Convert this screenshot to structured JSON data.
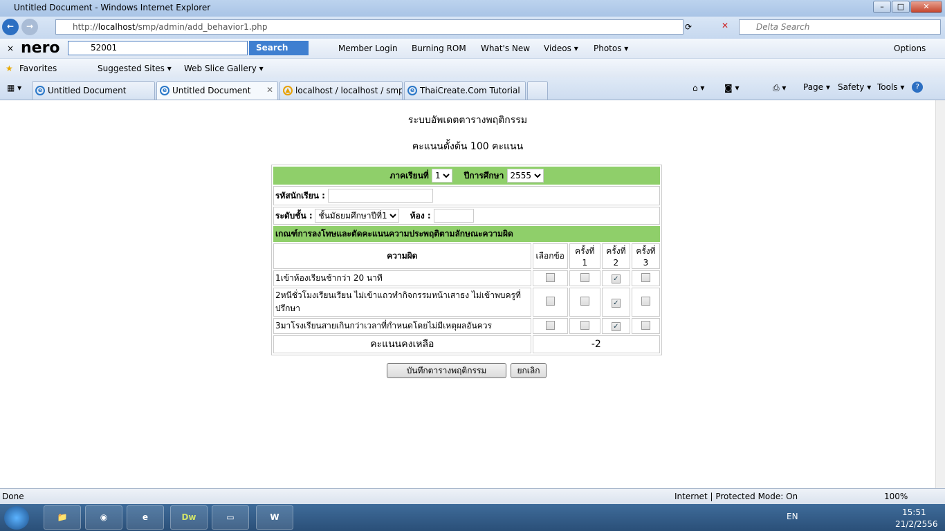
{
  "window": {
    "title": "Untitled Document - Windows Internet Explorer"
  },
  "nav": {
    "url_prefix": "http://",
    "url_host": "localhost",
    "url_path": "/smp/admin/add_behavior1.php",
    "search_placeholder": "Delta Search"
  },
  "nero": {
    "query": "52001",
    "search_label": "Search",
    "items": [
      "Member Login",
      "Burning ROM",
      "What's New",
      "Videos ▾",
      "Photos ▾"
    ],
    "options": "Options"
  },
  "favorites": {
    "label": "Favorites",
    "items": [
      "Suggested Sites ▾",
      "Web Slice Gallery ▾"
    ]
  },
  "tabs": [
    {
      "label": "Untitled Document"
    },
    {
      "label": "Untitled Document"
    },
    {
      "label": "localhost / localhost / smp..."
    },
    {
      "label": "ThaiCreate.Com Tutorial"
    }
  ],
  "command_bar": {
    "page": "Page ▾",
    "safety": "Safety ▾",
    "tools": "Tools ▾",
    "help": "?"
  },
  "page": {
    "title": "ระบบอัพเดตตารางพฤติกรรม",
    "subtitle": "คะแนนตั้งต้น 100 คะแนน",
    "term_label": "ภาคเรียนที่",
    "term_value": "1",
    "year_label": "ปีการศึกษา",
    "year_value": "2555",
    "student_id_label": "รหัสนักเรียน :",
    "student_id_value": "",
    "level_label": "ระดับชั้น :",
    "level_value": "ชั้นมัธยมศึกษาปีที่1",
    "room_label": "ห้อง :",
    "room_value": "",
    "criteria_header": "เกณฑ์การลงโทษและตัดคะแนนความประพฤติตามลักษณะความผิด",
    "columns": [
      "ความผิด",
      "เลือกข้อ",
      "ครั้งที่ 1",
      "ครั้งที่ 2",
      "ครั้งที่ 3"
    ],
    "rows": [
      {
        "text": "1เข้าห้องเรียนช้ากว่า 20 นาที",
        "checks": [
          false,
          false,
          true,
          false
        ]
      },
      {
        "text": "2หนีชั่วโมงเรียนเรียน ไม่เข้าแถวทำกิจกรรมหน้าเสาธง ไม่เข้าพบครูที่ปรึกษา",
        "checks": [
          false,
          false,
          true,
          false
        ]
      },
      {
        "text": "3มาโรงเรียนสายเกินกว่าเวลาที่กำหนดโดยไม่มีเหตุผลอันควร",
        "checks": [
          false,
          false,
          true,
          false
        ]
      }
    ],
    "remaining_label": "คะแนนคงเหลือ",
    "remaining_value": "-2",
    "save_button": "บันทึกตารางพฤติกรรม",
    "cancel_button": "ยกเลิก"
  },
  "status": {
    "text": "Done",
    "zone": "Internet | Protected Mode: On",
    "zoom": "100%"
  },
  "taskbar": {
    "lang": "EN",
    "time": "15:51",
    "date": "21/2/2556",
    "apps": [
      "Explorer",
      "Chrome",
      "IE",
      "Dw",
      "Notepad",
      "W"
    ]
  }
}
